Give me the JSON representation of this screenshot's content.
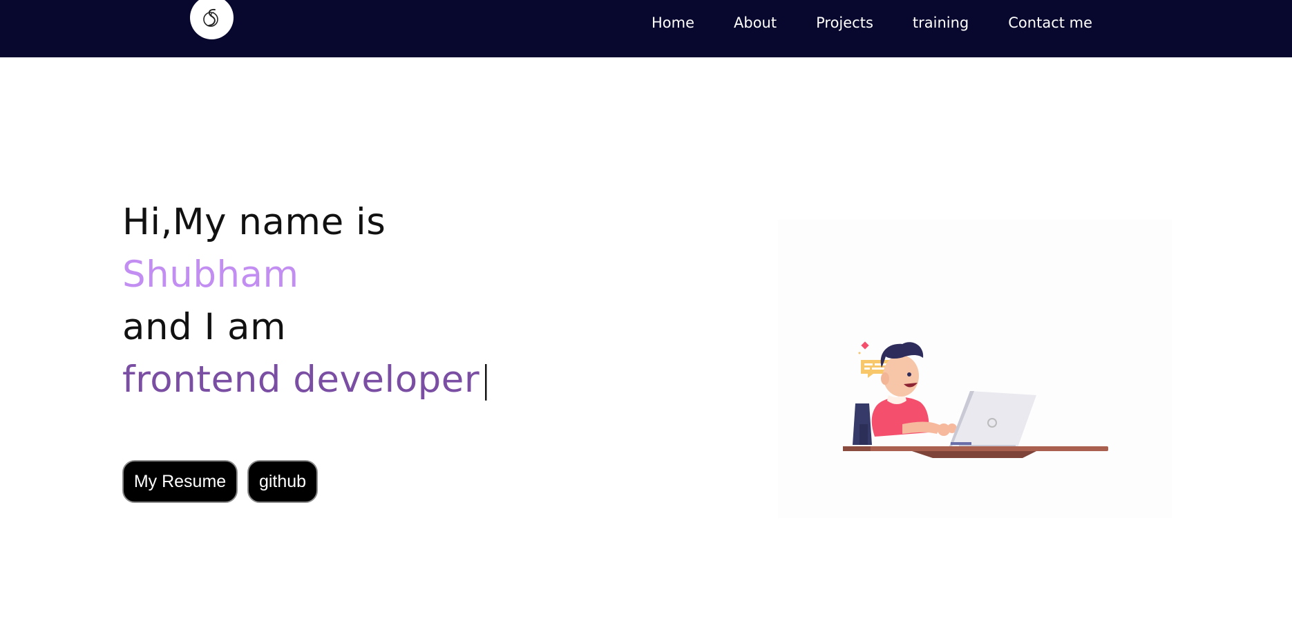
{
  "header": {
    "logo_icon": "signature-s-logo-icon",
    "nav": [
      "Home",
      "About",
      "Projects",
      "training",
      "Contact me"
    ]
  },
  "hero": {
    "greeting": "Hi,My name is",
    "name": "Shubham",
    "connector": "and I am",
    "role": "frontend developer",
    "cursor": "|"
  },
  "buttons": {
    "resume": "My Resume",
    "github": "github"
  },
  "illustration": {
    "icon": "developer-at-laptop-illustration"
  },
  "colors": {
    "navbar_bg": "#08082e",
    "name": "#c28ef2",
    "role": "#7a4fa3",
    "shirt": "#f4506d",
    "desk": "#a9604f"
  }
}
